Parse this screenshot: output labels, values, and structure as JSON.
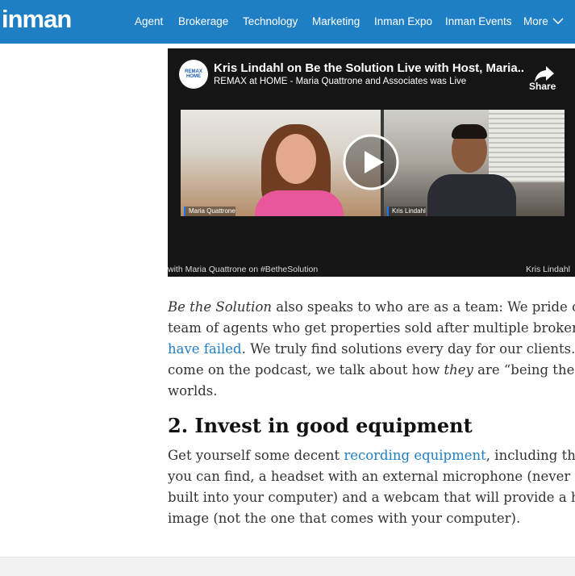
{
  "header": {
    "logo": "inman",
    "nav": [
      "Agent",
      "Brokerage",
      "Technology",
      "Marketing",
      "Inman Expo",
      "Inman Events",
      "More"
    ]
  },
  "video": {
    "title": "Kris Lindahl on Be the Solution Live with Host, Maria...",
    "subtitle": "REMAX at HOME - Maria Quattrone and Associates was Live",
    "share_label": "Share",
    "avatar_text": "REMAX HOME",
    "left_name": "Maria Quattrone",
    "right_name": "Kris Lindahl",
    "caption_left": "with Maria Quattrone on #BetheSolution",
    "caption_right": "Kris Lindahl",
    "play_icon": "play-icon"
  },
  "article": {
    "para1": {
      "l1_italic": "Be the Solution",
      "l1_rest": " also speaks to who are as a team: We pride ours",
      "l2": "team of agents who get properties sold after multiple brokerag",
      "l3_link": "have failed",
      "l3_rest": ". We truly find solutions every day for our clients. W",
      "l4_a": "come on the podcast, we talk about how ",
      "l4_italic": "they",
      "l4_b": " are “being the sol",
      "l5": "worlds."
    },
    "heading": "2. Invest in good equipment",
    "para2": {
      "l1_a": "Get yourself some decent ",
      "l1_link": "recording equipment",
      "l1_b": ", including the",
      "l2": "you can find, a headset with an external microphone (never us",
      "l3": "built into your computer) and a webcam that will provide a hig",
      "l4": "image (not the one that comes with your computer)."
    }
  },
  "colors": {
    "brand_blue": "#1f7fc4",
    "link_blue": "#1f7fc4",
    "video_bg": "#151515"
  }
}
